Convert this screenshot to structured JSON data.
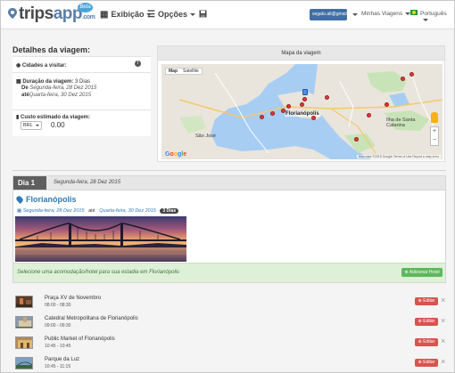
{
  "navbar": {
    "logo_main": "trips",
    "logo_app": "app",
    "logo_com": ".com",
    "beta_label": "Beta",
    "menu_view": "Exibição",
    "menu_options": "Opções",
    "user_email": "segato.alt@gmail.com",
    "menu_my_trips": "Minhas Viagens",
    "menu_language": "Português"
  },
  "details": {
    "title": "Detalhes da viagem:",
    "cities_label": "Cidades a visitar:",
    "duration_label": "Duração da viagem:",
    "duration_value": "3 Dias",
    "from_label": "De",
    "from_date": "Segunda-feira, 28 Dez 2015",
    "to_label": "até",
    "to_date": "Quarta-feira, 30 Dez 2015",
    "cost_label": "Custo estimado da viagem:",
    "currency": "BRL",
    "cost_value": "0.00"
  },
  "map": {
    "title": "Mapa da viagem",
    "type_map": "Map",
    "type_satellite": "Satellite",
    "city_main": "Florianópolis",
    "label_sao_jose": "São José",
    "label_ilha": "Ilha de Santa Catarina",
    "google_label": "Google",
    "footer": "Map data ©2015 Google   Terms of Use   Report a map error",
    "zoom_in": "+",
    "zoom_out": "−"
  },
  "day": {
    "tab_label": "Dia 1",
    "date": "Segunda-feira, 28 Dez 2015",
    "destination": "Florianópolis",
    "dest_from": "Segunda-feira, 28 Dez 2015",
    "dest_to_label": "até",
    "dest_to": "Quarta-feira, 30 Dez 2015",
    "dest_days": "3 Dias",
    "hotel_prompt": "Selecione uma acomodação/hotel para sua estadia em Florianópolis",
    "add_hotel_label": "Adicionar Hotel"
  },
  "activities": [
    {
      "name": "Praça XV de Novembro",
      "time": "08:00 - 08:30",
      "edit": "Editar"
    },
    {
      "name": "Catedral Metropolitana de Florianópolis",
      "time": "09:00 - 09:30",
      "edit": "Editar"
    },
    {
      "name": "Public Market of Florianópolis",
      "time": "10:45 - 10:45",
      "edit": "Editar"
    },
    {
      "name": "Parque da Luz",
      "time": "10:45 - 11:15",
      "edit": "Editar"
    }
  ],
  "colors": {
    "accent_blue": "#2f78b6",
    "danger": "#d9534f",
    "success": "#5cb85c",
    "success_bg": "#dff0d8"
  }
}
